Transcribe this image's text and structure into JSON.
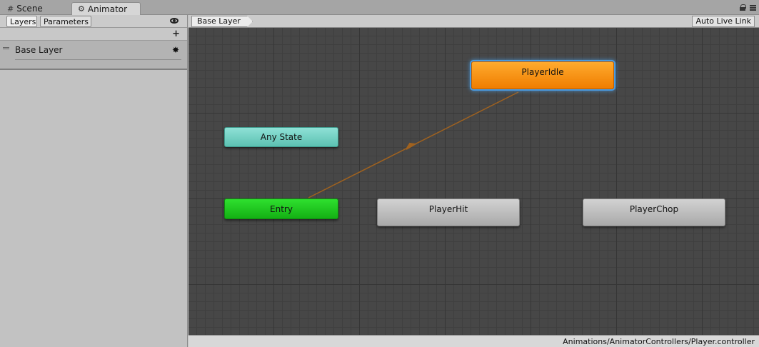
{
  "window_tabs": [
    {
      "label": "Scene",
      "icon": "grid-icon"
    },
    {
      "label": "Animator",
      "icon": "animator-icon"
    }
  ],
  "panel_tabs": {
    "layers": "Layers",
    "parameters": "Parameters"
  },
  "layers": [
    {
      "name": "Base Layer"
    }
  ],
  "breadcrumb": "Base Layer",
  "auto_live_link": "Auto Live Link",
  "states": {
    "any_state": "Any State",
    "entry": "Entry",
    "player_idle": "PlayerIdle",
    "player_hit": "PlayerHit",
    "player_chop": "PlayerChop"
  },
  "status_path": "Animations/AnimatorControllers/Player.controller",
  "colors": {
    "default_state": "#ef7d00",
    "entry": "#14b014",
    "any_state": "#5cc1b2",
    "transition": "#a0621f",
    "selection": "#4a9adf"
  }
}
